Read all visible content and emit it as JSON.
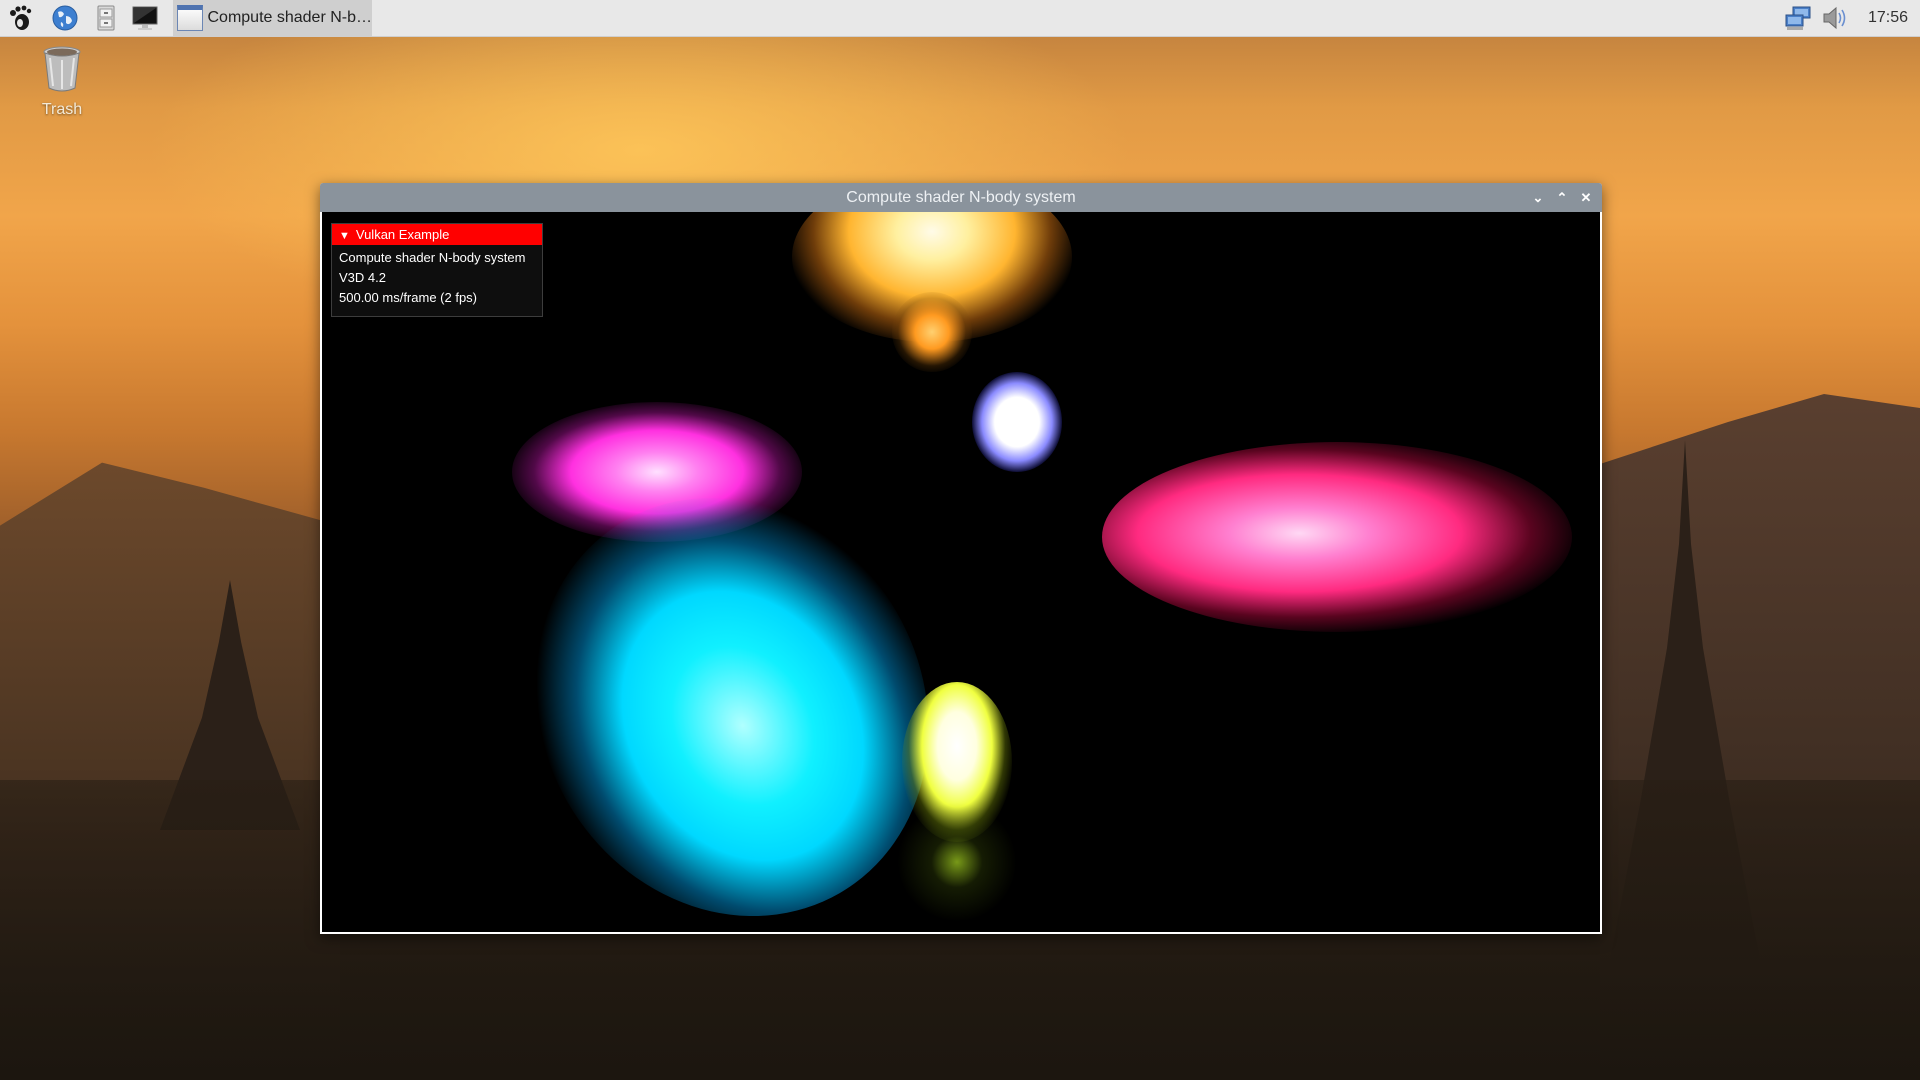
{
  "taskbar": {
    "launchers": [
      {
        "name": "menu",
        "icon": "gnome-foot-icon"
      },
      {
        "name": "web-browser",
        "icon": "globe-icon"
      },
      {
        "name": "file-manager",
        "icon": "filing-cabinet-icon"
      },
      {
        "name": "terminal",
        "icon": "monitor-icon"
      }
    ],
    "task_button_label": "Compute shader N-b…",
    "tray": {
      "network_icon": "network-icon",
      "volume_icon": "speaker-icon"
    },
    "clock": "17:56"
  },
  "desktop": {
    "icons": [
      {
        "label": "Trash",
        "icon": "trash-icon"
      }
    ]
  },
  "window": {
    "title": "Compute shader N-body system",
    "controls": {
      "minimize": "⌄",
      "maximize": "⌃",
      "close": "✕"
    },
    "overlay": {
      "header": "Vulkan Example",
      "lines": [
        "Compute shader N-body system",
        "V3D 4.2",
        "500.00 ms/frame (2 fps)"
      ],
      "header_color": "#ff0000"
    },
    "clusters": [
      {
        "name": "orange-cluster",
        "color": "#ffb030"
      },
      {
        "name": "blue-white-cluster",
        "color": "#8f8fff"
      },
      {
        "name": "magenta-cluster",
        "color": "#ff40e0"
      },
      {
        "name": "pink-red-cluster",
        "color": "#ff2070"
      },
      {
        "name": "cyan-cluster",
        "color": "#00e8ff"
      },
      {
        "name": "yellow-cluster",
        "color": "#f0ff40"
      }
    ]
  }
}
